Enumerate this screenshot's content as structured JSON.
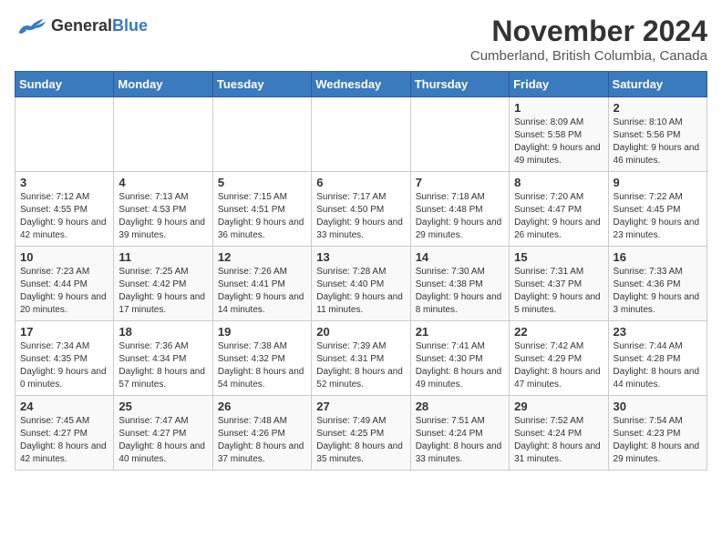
{
  "logo": {
    "general": "General",
    "blue": "Blue"
  },
  "title": "November 2024",
  "location": "Cumberland, British Columbia, Canada",
  "weekdays": [
    "Sunday",
    "Monday",
    "Tuesday",
    "Wednesday",
    "Thursday",
    "Friday",
    "Saturday"
  ],
  "weeks": [
    [
      {
        "day": "",
        "info": ""
      },
      {
        "day": "",
        "info": ""
      },
      {
        "day": "",
        "info": ""
      },
      {
        "day": "",
        "info": ""
      },
      {
        "day": "",
        "info": ""
      },
      {
        "day": "1",
        "info": "Sunrise: 8:09 AM\nSunset: 5:58 PM\nDaylight: 9 hours and 49 minutes."
      },
      {
        "day": "2",
        "info": "Sunrise: 8:10 AM\nSunset: 5:56 PM\nDaylight: 9 hours and 46 minutes."
      }
    ],
    [
      {
        "day": "3",
        "info": "Sunrise: 7:12 AM\nSunset: 4:55 PM\nDaylight: 9 hours and 42 minutes."
      },
      {
        "day": "4",
        "info": "Sunrise: 7:13 AM\nSunset: 4:53 PM\nDaylight: 9 hours and 39 minutes."
      },
      {
        "day": "5",
        "info": "Sunrise: 7:15 AM\nSunset: 4:51 PM\nDaylight: 9 hours and 36 minutes."
      },
      {
        "day": "6",
        "info": "Sunrise: 7:17 AM\nSunset: 4:50 PM\nDaylight: 9 hours and 33 minutes."
      },
      {
        "day": "7",
        "info": "Sunrise: 7:18 AM\nSunset: 4:48 PM\nDaylight: 9 hours and 29 minutes."
      },
      {
        "day": "8",
        "info": "Sunrise: 7:20 AM\nSunset: 4:47 PM\nDaylight: 9 hours and 26 minutes."
      },
      {
        "day": "9",
        "info": "Sunrise: 7:22 AM\nSunset: 4:45 PM\nDaylight: 9 hours and 23 minutes."
      }
    ],
    [
      {
        "day": "10",
        "info": "Sunrise: 7:23 AM\nSunset: 4:44 PM\nDaylight: 9 hours and 20 minutes."
      },
      {
        "day": "11",
        "info": "Sunrise: 7:25 AM\nSunset: 4:42 PM\nDaylight: 9 hours and 17 minutes."
      },
      {
        "day": "12",
        "info": "Sunrise: 7:26 AM\nSunset: 4:41 PM\nDaylight: 9 hours and 14 minutes."
      },
      {
        "day": "13",
        "info": "Sunrise: 7:28 AM\nSunset: 4:40 PM\nDaylight: 9 hours and 11 minutes."
      },
      {
        "day": "14",
        "info": "Sunrise: 7:30 AM\nSunset: 4:38 PM\nDaylight: 9 hours and 8 minutes."
      },
      {
        "day": "15",
        "info": "Sunrise: 7:31 AM\nSunset: 4:37 PM\nDaylight: 9 hours and 5 minutes."
      },
      {
        "day": "16",
        "info": "Sunrise: 7:33 AM\nSunset: 4:36 PM\nDaylight: 9 hours and 3 minutes."
      }
    ],
    [
      {
        "day": "17",
        "info": "Sunrise: 7:34 AM\nSunset: 4:35 PM\nDaylight: 9 hours and 0 minutes."
      },
      {
        "day": "18",
        "info": "Sunrise: 7:36 AM\nSunset: 4:34 PM\nDaylight: 8 hours and 57 minutes."
      },
      {
        "day": "19",
        "info": "Sunrise: 7:38 AM\nSunset: 4:32 PM\nDaylight: 8 hours and 54 minutes."
      },
      {
        "day": "20",
        "info": "Sunrise: 7:39 AM\nSunset: 4:31 PM\nDaylight: 8 hours and 52 minutes."
      },
      {
        "day": "21",
        "info": "Sunrise: 7:41 AM\nSunset: 4:30 PM\nDaylight: 8 hours and 49 minutes."
      },
      {
        "day": "22",
        "info": "Sunrise: 7:42 AM\nSunset: 4:29 PM\nDaylight: 8 hours and 47 minutes."
      },
      {
        "day": "23",
        "info": "Sunrise: 7:44 AM\nSunset: 4:28 PM\nDaylight: 8 hours and 44 minutes."
      }
    ],
    [
      {
        "day": "24",
        "info": "Sunrise: 7:45 AM\nSunset: 4:27 PM\nDaylight: 8 hours and 42 minutes."
      },
      {
        "day": "25",
        "info": "Sunrise: 7:47 AM\nSunset: 4:27 PM\nDaylight: 8 hours and 40 minutes."
      },
      {
        "day": "26",
        "info": "Sunrise: 7:48 AM\nSunset: 4:26 PM\nDaylight: 8 hours and 37 minutes."
      },
      {
        "day": "27",
        "info": "Sunrise: 7:49 AM\nSunset: 4:25 PM\nDaylight: 8 hours and 35 minutes."
      },
      {
        "day": "28",
        "info": "Sunrise: 7:51 AM\nSunset: 4:24 PM\nDaylight: 8 hours and 33 minutes."
      },
      {
        "day": "29",
        "info": "Sunrise: 7:52 AM\nSunset: 4:24 PM\nDaylight: 8 hours and 31 minutes."
      },
      {
        "day": "30",
        "info": "Sunrise: 7:54 AM\nSunset: 4:23 PM\nDaylight: 8 hours and 29 minutes."
      }
    ]
  ]
}
